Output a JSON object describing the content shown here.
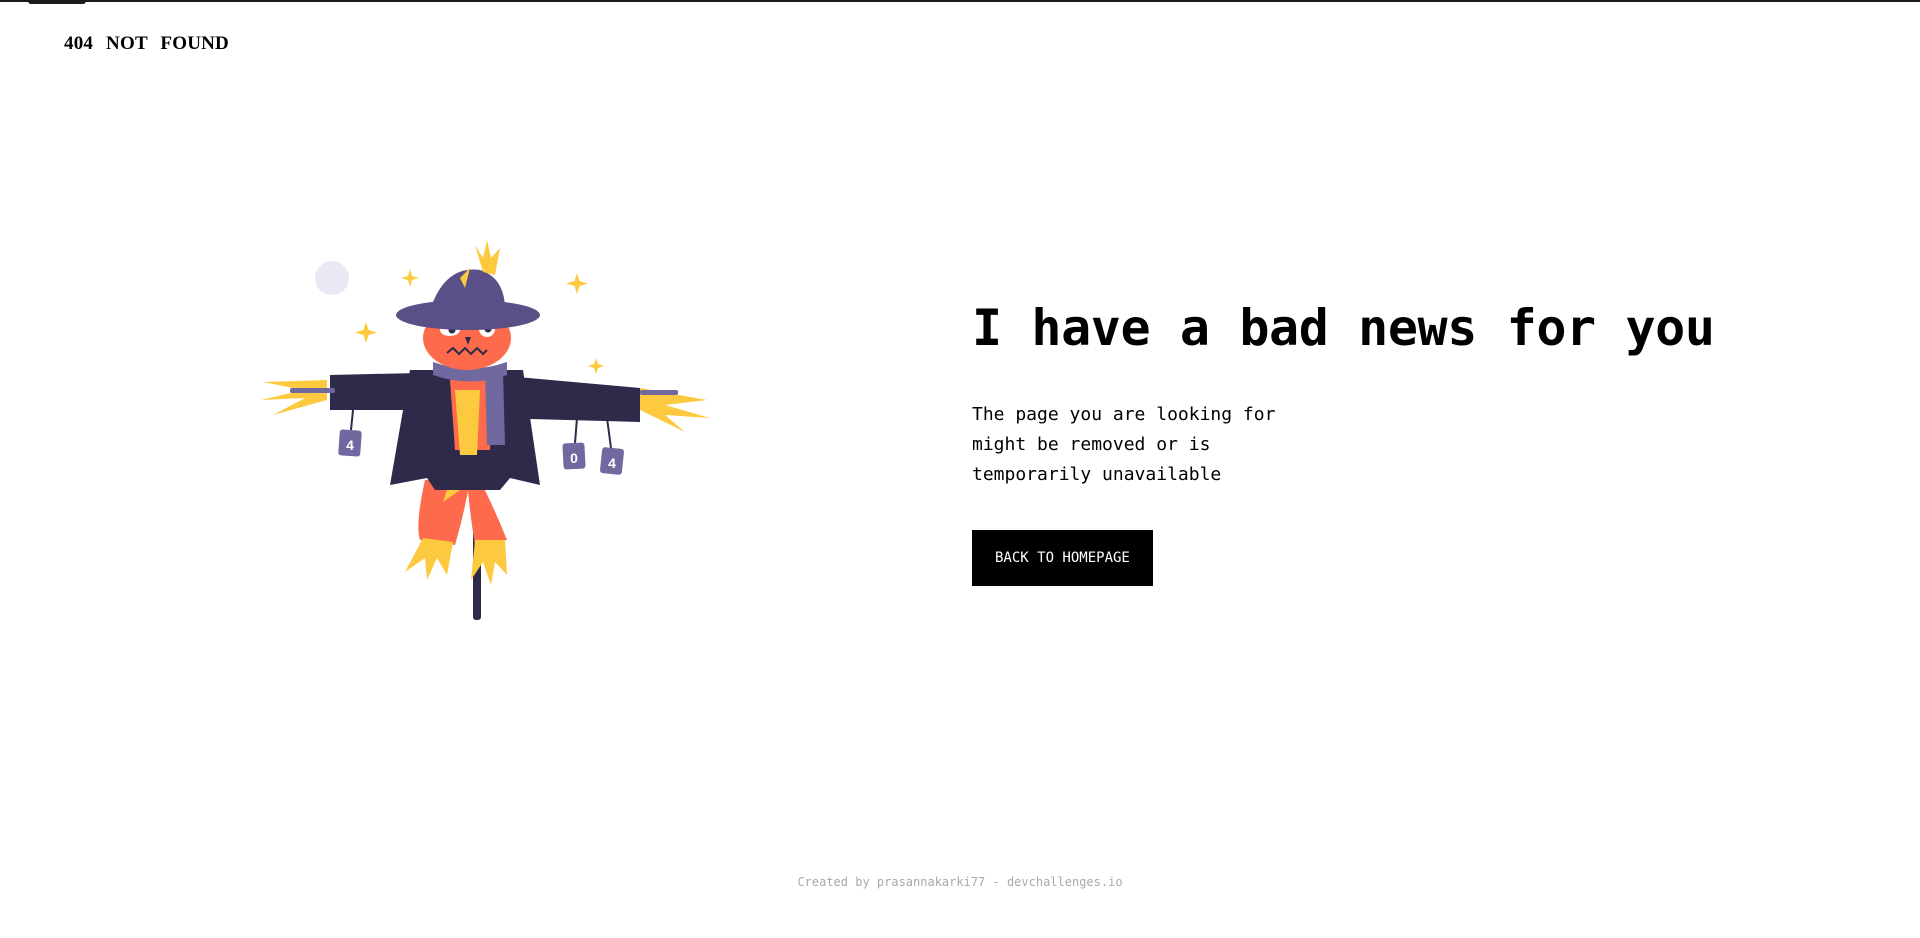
{
  "header": {
    "brand": "404 NOT FOUND"
  },
  "illustration": {
    "icon": "scarecrow-illustration",
    "can_labels": [
      "4",
      "0",
      "4"
    ]
  },
  "main": {
    "headline": "I have a bad news for you",
    "message": "The page you are looking for might be removed or is temporarily unavailable",
    "button_label": "BACK TO HOMEPAGE"
  },
  "footer": {
    "credit": "Created by prasannakarki77 - devchallenges.io"
  },
  "colors": {
    "background": "#ffffff",
    "text": "#000000",
    "button_bg": "#000000",
    "button_text": "#ffffff",
    "footer_text": "#a9a9a9",
    "scarecrow_coat": "#2e2a4a",
    "scarecrow_hat": "#5a4f86",
    "scarecrow_face": "#fe6a4c",
    "straw": "#fdc93f",
    "scarf": "#6f69a0",
    "moon": "#e8e9f3"
  }
}
